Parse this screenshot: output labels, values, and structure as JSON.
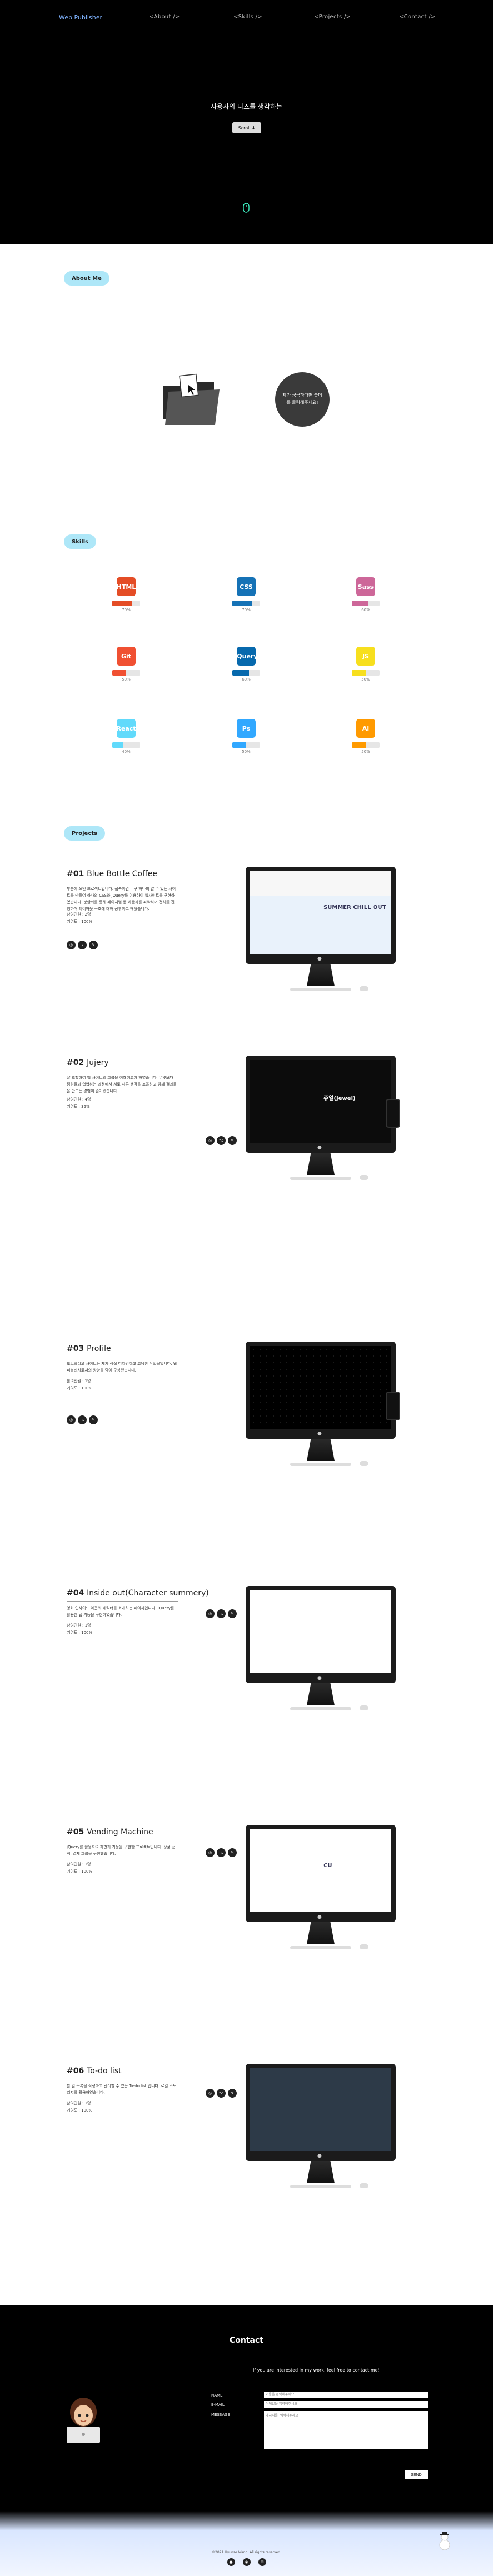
{
  "nav": {
    "logo": "Web Publisher",
    "links": [
      "<About />",
      "<Skills />",
      "<Projects />",
      "<Contact />"
    ]
  },
  "hero": {
    "title": "사용자의 니즈를 생각하는",
    "button": "Scroll"
  },
  "about": {
    "tag": "About Me",
    "bubble": "제가 궁금하다면 폴더를 클릭해주세요!"
  },
  "skills": {
    "tag": "Skills",
    "items": [
      {
        "name": "HTML",
        "icon": "html5-icon",
        "color": "#e44d26",
        "level": 0.7,
        "pct": "70%"
      },
      {
        "name": "CSS",
        "icon": "css3-icon",
        "color": "#1572b6",
        "level": 0.7,
        "pct": "70%"
      },
      {
        "name": "Sass",
        "icon": "sass-icon",
        "color": "#cd6799",
        "level": 0.6,
        "pct": "60%"
      },
      {
        "name": "Git",
        "icon": "git-icon",
        "color": "#f05032",
        "level": 0.5,
        "pct": "50%"
      },
      {
        "name": "jQuery",
        "icon": "jquery-icon",
        "color": "#0769ad",
        "level": 0.6,
        "pct": "60%"
      },
      {
        "name": "JS",
        "icon": "javascript-icon",
        "color": "#f7df1e",
        "level": 0.5,
        "pct": "50%"
      },
      {
        "name": "React",
        "icon": "react-icon",
        "color": "#61dafb",
        "level": 0.4,
        "pct": "40%"
      },
      {
        "name": "Ps",
        "icon": "photoshop-icon",
        "color": "#31a8ff",
        "level": 0.5,
        "pct": "50%"
      },
      {
        "name": "Ai",
        "icon": "illustrator-icon",
        "color": "#ff9a00",
        "level": 0.5,
        "pct": "50%"
      }
    ]
  },
  "projects": {
    "tag": "Projects",
    "items": [
      {
        "num": "#01",
        "title": "Blue Bottle Coffee",
        "desc": "부분에 쓰인 프로젝트입니다. 접속하면 누구 하나의 알 수 있는 사이트를 만들어 하나의 CSS와 jQuery를 이용하여 웹사이트를 구현하였습니다. 분할화를 통해 페이지별 웹 사용자를 파악하며 전체를 진행하며 레이아웃 구조에 대해 공부하고 배웠습니다.",
        "meta": [
          "참여인원 : 2명",
          "기여도 : 100%"
        ],
        "screen_text": "SUMMER CHILL OUT"
      },
      {
        "num": "#02",
        "title": "Jujery",
        "desc": "잘 조합하여 웹 사이트의 흐름을 이해하고자 하였습니다. 무엇보다 팀원들과 협업하는 과정에서 서로 다른 생각을 조율하고 함께 결과물을 만드는 경험이 즐거웠습니다.",
        "meta": [
          "참여인원 : 4명",
          "기여도 : 35%"
        ],
        "screen_text": "쥬얼(Jewel)"
      },
      {
        "num": "#03",
        "title": "Profile",
        "desc": "포트폴리오 사이트는 제가 직접 디자인하고 코딩한 작업물입니다. 웹 퍼블리셔로서의 방향을 담아 구성했습니다.",
        "meta": [
          "참여인원 : 1명",
          "기여도 : 100%"
        ],
        "screen_text": ""
      },
      {
        "num": "#04",
        "title": "Inside out(Character summery)",
        "desc": "영화 인사이드 아웃의 캐릭터를 소개하는 페이지입니다. jQuery를 활용한 탭 기능을 구현하였습니다.",
        "meta": [
          "참여인원 : 1명",
          "기여도 : 100%"
        ],
        "screen_text": ""
      },
      {
        "num": "#05",
        "title": "Vending Machine",
        "desc": "jQuery를 활용하여 자판기 기능을 구현한 프로젝트입니다. 상품 선택, 결제 흐름을 구현했습니다.",
        "meta": [
          "참여인원 : 1명",
          "기여도 : 100%"
        ],
        "screen_text": "CU"
      },
      {
        "num": "#06",
        "title": "To-do list",
        "desc": "할 일 목록을 작성하고 관리할 수 있는 To-do list 입니다. 로컬 스토리지를 활용하였습니다.",
        "meta": [
          "참여인원 : 1명",
          "기여도 : 100%"
        ],
        "screen_text": ""
      }
    ]
  },
  "contact": {
    "title": "Contact",
    "subtitle": "If you are interested in my work, feel free to contact me!",
    "name_label": "NAME",
    "email_label": "E-MAIL",
    "message_label": "MESSAGE",
    "name_placeholder": "이름을 입력해주세요",
    "email_placeholder": "이메일을 입력해주세요",
    "message_placeholder": "메시지를 입력해주세요",
    "send_label": "SEND",
    "copyright": "©2021 Hyunse Wang. All rights reserved."
  }
}
